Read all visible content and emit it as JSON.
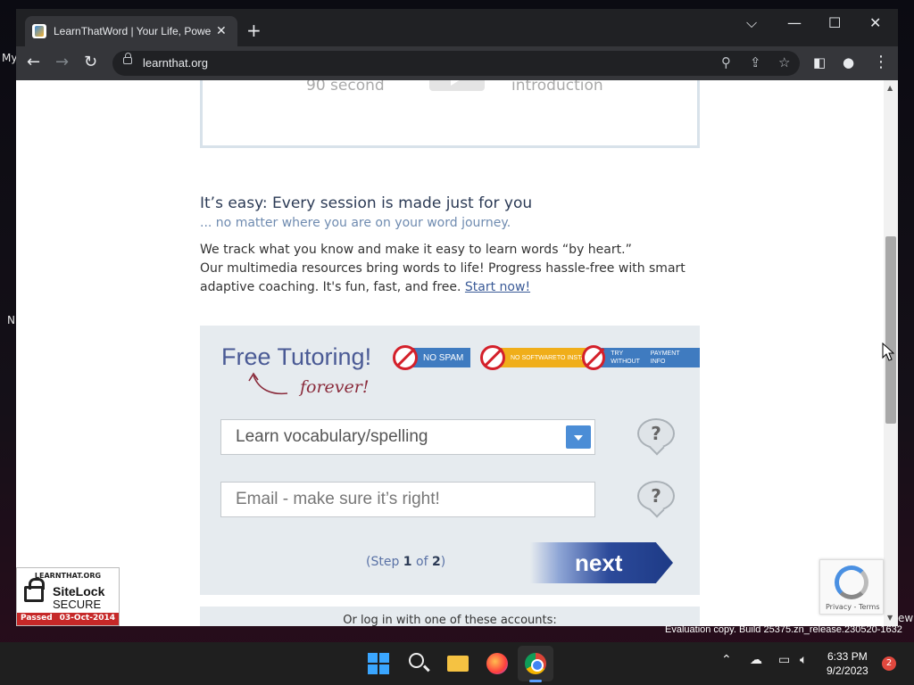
{
  "desktop": {
    "label_my": "My",
    "label_n": "N",
    "label_ew": "ew",
    "eval_text": "Evaluation copy. Build 25375.zn_release.230520-1632"
  },
  "browser": {
    "tab_title": "LearnThatWord | Your Life, Power",
    "url": "learnthat.org",
    "icons": [
      "back-icon",
      "forward-icon",
      "reload-icon",
      "lock-icon",
      "search-icon",
      "share-icon",
      "star-icon",
      "sidepanel-icon",
      "profile-icon",
      "menu-icon"
    ]
  },
  "page": {
    "video": {
      "left_text": "90 second",
      "right_text": "introduction"
    },
    "easy_heading": "It’s easy: Every session is made just for you",
    "easy_sub": "... no matter where you are on your word journey.",
    "body_line1": "We track what you know and make it easy to learn words “by heart.”",
    "body_line2": "Our multimedia resources bring words to life! Progress hassle-free with smart adaptive coaching. It's fun, fast, and free.",
    "start_link": "Start now!",
    "free_title": "Free Tutoring!",
    "forever": "forever!",
    "badges": {
      "no_spam": "NO SPAM",
      "no_software_1": "NO SOFTWARE",
      "no_software_2": "TO INSTALL",
      "try_1": "TRY WITHOUT",
      "try_2": "PAYMENT INFO"
    },
    "select_value": "Learn vocabulary/spelling",
    "email_placeholder": "Email - make sure it’s right!",
    "help_symbol": "?",
    "step_prefix": "(Step ",
    "step_current": "1",
    "step_of": " of ",
    "step_total": "2",
    "step_suffix": ")",
    "next_label": "next",
    "login_text": "Or log in with one of these accounts:"
  },
  "sitelock": {
    "domain": "LEARNTHAT.ORG",
    "name": "SiteLock",
    "secure": "SECURE",
    "passed": "Passed",
    "date": "03-Oct-2014"
  },
  "recaptcha": {
    "privacy": "Privacy",
    "sep": " - ",
    "terms": "Terms"
  },
  "taskbar": {
    "time": "6:33 PM",
    "date": "9/2/2023",
    "notif_count": "2"
  }
}
